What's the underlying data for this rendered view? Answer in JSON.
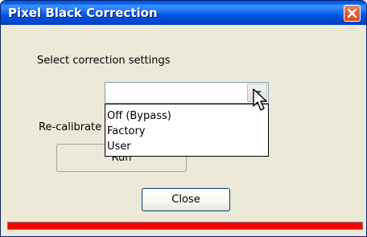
{
  "window": {
    "title": "Pixel Black Correction"
  },
  "prompt_label": "Select correction settings",
  "combo": {
    "selected_value": "",
    "options": [
      "Off (Bypass)",
      "Factory",
      "User"
    ]
  },
  "recalibrate_label": "Re-calibrate",
  "run_button": "Run",
  "close_button": "Close",
  "colors": {
    "titlebar": "#0054e3",
    "status_bar": "#ff0000",
    "dialog_bg": "#ece9d8"
  }
}
